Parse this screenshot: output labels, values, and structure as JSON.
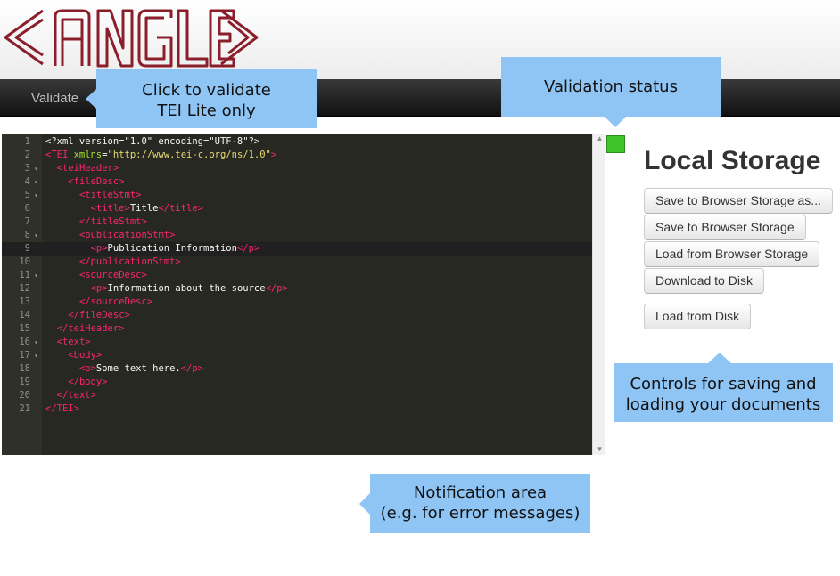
{
  "logo": {
    "text": "ANGLES"
  },
  "navbar": {
    "validate_label": "Validate"
  },
  "editor": {
    "lines": [
      {
        "n": "1",
        "fold": false
      },
      {
        "n": "2",
        "fold": false
      },
      {
        "n": "3",
        "fold": true
      },
      {
        "n": "4",
        "fold": true
      },
      {
        "n": "5",
        "fold": true
      },
      {
        "n": "6",
        "fold": false
      },
      {
        "n": "7",
        "fold": false
      },
      {
        "n": "8",
        "fold": true
      },
      {
        "n": "9",
        "fold": false
      },
      {
        "n": "10",
        "fold": false
      },
      {
        "n": "11",
        "fold": true
      },
      {
        "n": "12",
        "fold": false
      },
      {
        "n": "13",
        "fold": false
      },
      {
        "n": "14",
        "fold": false
      },
      {
        "n": "15",
        "fold": false
      },
      {
        "n": "16",
        "fold": true
      },
      {
        "n": "17",
        "fold": true
      },
      {
        "n": "18",
        "fold": false
      },
      {
        "n": "19",
        "fold": false
      },
      {
        "n": "20",
        "fold": false
      },
      {
        "n": "21",
        "fold": false
      }
    ],
    "code": [
      [
        [
          "pi",
          "<?xml version=\"1.0\" encoding=\"UTF-8\"?>"
        ]
      ],
      [
        [
          "tag",
          "<TEI "
        ],
        [
          "attr",
          "xmlns"
        ],
        [
          "pi",
          "="
        ],
        [
          "str",
          "\"http://www.tei-c.org/ns/1.0\""
        ],
        [
          "tag",
          ">"
        ]
      ],
      [
        [
          "pi",
          "  "
        ],
        [
          "tag",
          "<teiHeader>"
        ]
      ],
      [
        [
          "pi",
          "    "
        ],
        [
          "tag",
          "<fileDesc>"
        ]
      ],
      [
        [
          "pi",
          "      "
        ],
        [
          "tag",
          "<titleStmt>"
        ]
      ],
      [
        [
          "pi",
          "        "
        ],
        [
          "tag",
          "<title>"
        ],
        [
          "pi",
          "Title"
        ],
        [
          "tag",
          "</title>"
        ]
      ],
      [
        [
          "pi",
          "      "
        ],
        [
          "tag",
          "</titleStmt>"
        ]
      ],
      [
        [
          "pi",
          "      "
        ],
        [
          "tag",
          "<publicationStmt>"
        ]
      ],
      [
        [
          "pi",
          "        "
        ],
        [
          "tag",
          "<p>"
        ],
        [
          "pi",
          "Publication Information"
        ],
        [
          "tag",
          "</p>"
        ]
      ],
      [
        [
          "pi",
          "      "
        ],
        [
          "tag",
          "</publicationStmt>"
        ]
      ],
      [
        [
          "pi",
          "      "
        ],
        [
          "tag",
          "<sourceDesc>"
        ]
      ],
      [
        [
          "pi",
          "        "
        ],
        [
          "tag",
          "<p>"
        ],
        [
          "pi",
          "Information about the source"
        ],
        [
          "tag",
          "</p>"
        ]
      ],
      [
        [
          "pi",
          "      "
        ],
        [
          "tag",
          "</sourceDesc>"
        ]
      ],
      [
        [
          "pi",
          "    "
        ],
        [
          "tag",
          "</fileDesc>"
        ]
      ],
      [
        [
          "pi",
          "  "
        ],
        [
          "tag",
          "</teiHeader>"
        ]
      ],
      [
        [
          "pi",
          "  "
        ],
        [
          "tag",
          "<text>"
        ]
      ],
      [
        [
          "pi",
          "    "
        ],
        [
          "tag",
          "<body>"
        ]
      ],
      [
        [
          "pi",
          "      "
        ],
        [
          "tag",
          "<p>"
        ],
        [
          "pi",
          "Some text here."
        ],
        [
          "tag",
          "</p>"
        ]
      ],
      [
        [
          "pi",
          "    "
        ],
        [
          "tag",
          "</body>"
        ]
      ],
      [
        [
          "pi",
          "  "
        ],
        [
          "tag",
          "</text>"
        ]
      ],
      [
        [
          "tag",
          "</TEI>"
        ]
      ]
    ],
    "active_line": 9
  },
  "validation_status_color": "#3fc52a",
  "local_storage": {
    "title": "Local Storage",
    "buttons": [
      "Save to Browser Storage as...",
      "Save to Browser Storage",
      "Load from Browser Storage",
      "Download to Disk",
      "Load from Disk"
    ]
  },
  "callouts": {
    "validate": [
      "Click to validate",
      "TEI Lite only"
    ],
    "status": "Validation status",
    "controls": [
      "Controls for saving and",
      "loading your documents"
    ],
    "notification": [
      "Notification area",
      "(e.g. for error messages)"
    ]
  },
  "colors": {
    "callout": "#8fc5f5",
    "logo": "#8b1e2b",
    "status_ok": "#3fc52a"
  }
}
